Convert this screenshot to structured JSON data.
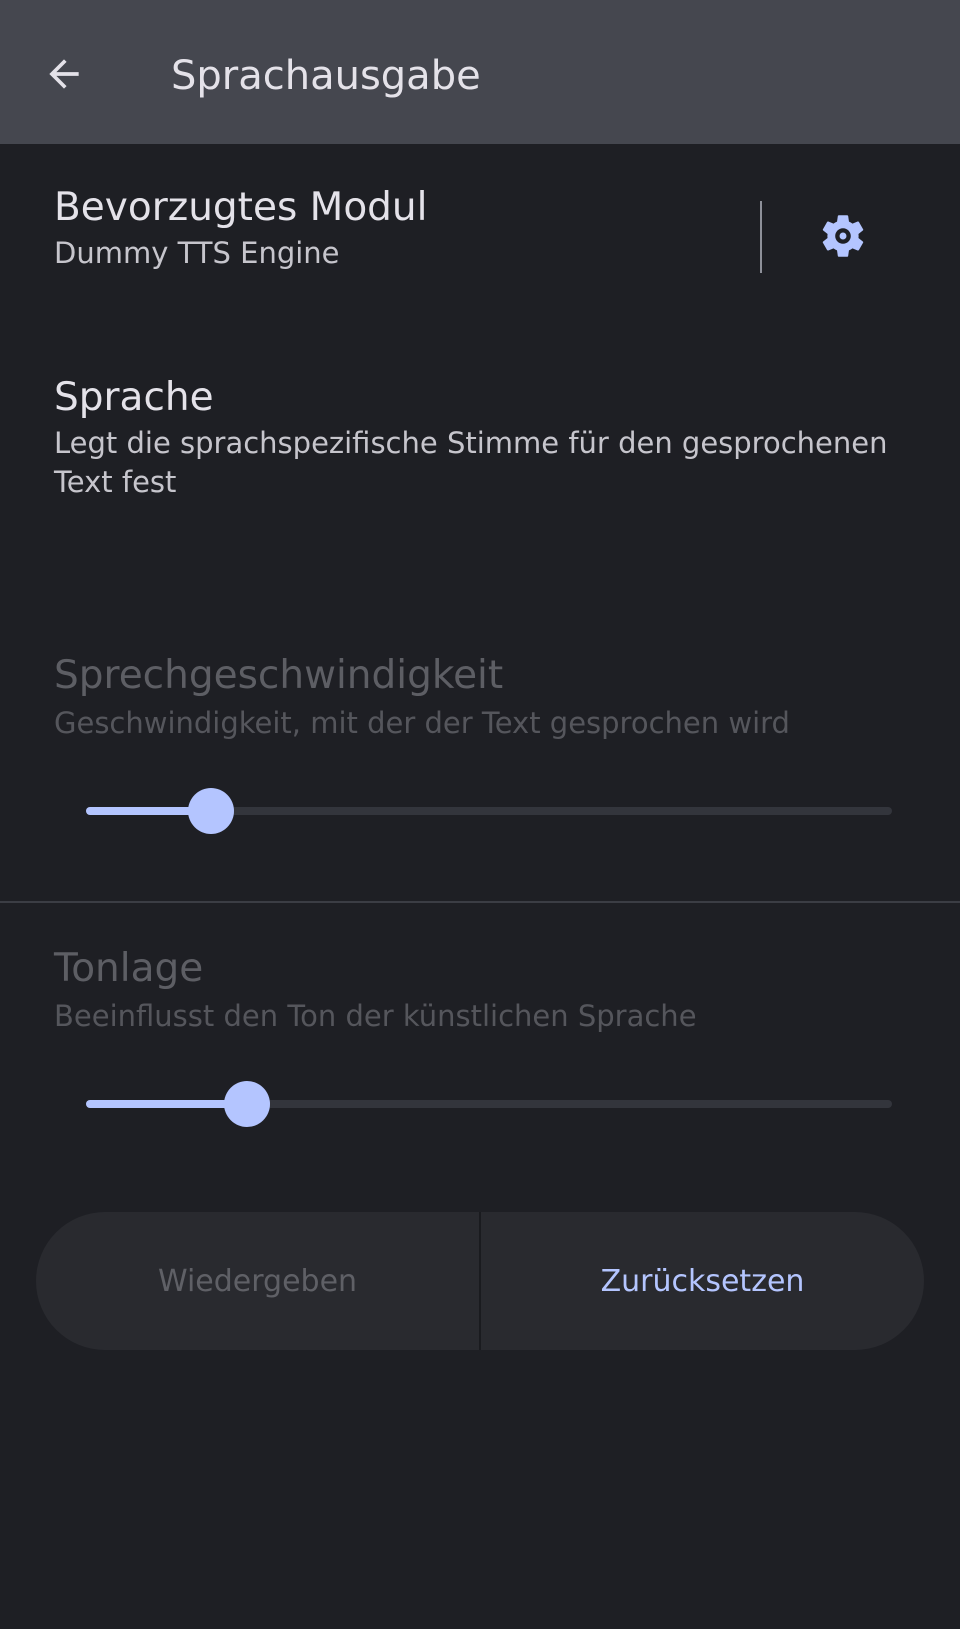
{
  "topbar": {
    "title": "Sprachausgabe",
    "back_icon": "arrow-back-icon"
  },
  "engine": {
    "title": "Bevorzugtes Modul",
    "summary": "Dummy TTS Engine",
    "settings_icon": "gear-icon"
  },
  "language": {
    "title": "Sprache",
    "summary": "Legt die sprachspezifische Stimme für den gesprochenen Text fest"
  },
  "speech_rate": {
    "title": "Sprechgeschwindigkeit",
    "summary": "Geschwindigkeit, mit der der Text gesprochen wird",
    "value_fraction": 0.155
  },
  "pitch": {
    "title": "Tonlage",
    "summary": "Beeinflusst den Ton der künstlichen Sprache",
    "value_fraction": 0.2
  },
  "actions": {
    "play_label": "Wiedergeben",
    "reset_label": "Zurücksetzen"
  },
  "colors": {
    "accent": "#b4c5ff",
    "background": "#1e1f24",
    "topbar": "#45474f"
  }
}
